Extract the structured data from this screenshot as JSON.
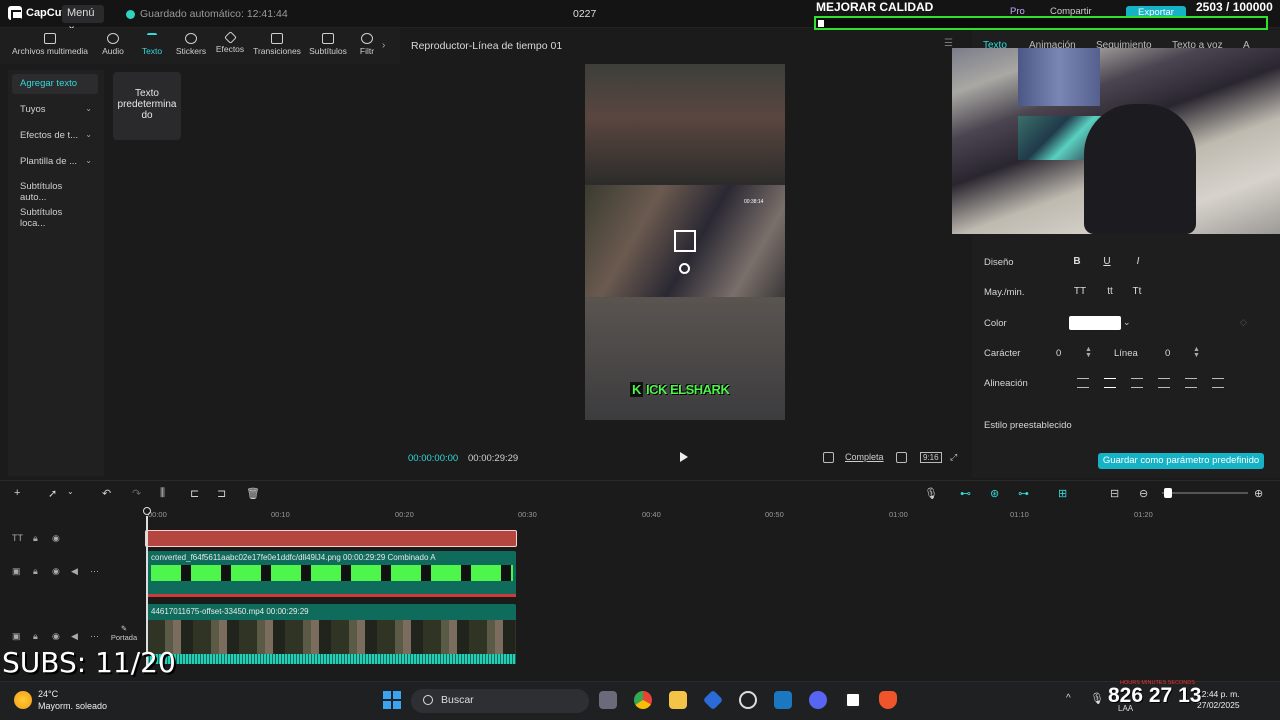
{
  "app": {
    "logo_text": "CapCut",
    "menu_label": "Menú",
    "autosave": "Guardado automático: 12:41:44",
    "project_name": "0227",
    "pro_label": "Pro",
    "share_label": "Compartir",
    "export_label": "Exportar"
  },
  "toolbar": {
    "items": [
      {
        "label": "Archivos multimedia",
        "icon": "media-icon"
      },
      {
        "label": "Audio",
        "icon": "audio-icon"
      },
      {
        "label": "Texto",
        "icon": "text-icon",
        "active": true
      },
      {
        "label": "Stickers",
        "icon": "sticker-icon"
      },
      {
        "label": "Efectos",
        "icon": "effects-icon"
      },
      {
        "label": "Transiciones",
        "icon": "transitions-icon"
      },
      {
        "label": "Subtítulos",
        "icon": "subtitles-icon"
      },
      {
        "label": "Filtr",
        "icon": "filters-icon"
      }
    ]
  },
  "left_panel": {
    "categories": [
      {
        "label": "Agregar texto",
        "active": true
      },
      {
        "label": "Tuyos",
        "dropdown": true
      },
      {
        "label": "Efectos de t...",
        "dropdown": true
      },
      {
        "label": "Plantilla de ...",
        "dropdown": true
      },
      {
        "label": "Subtítulos auto...",
        "dropdown": false
      },
      {
        "label": "Subtítulos loca...",
        "dropdown": false
      }
    ],
    "default_text_card": "Texto predetermina do"
  },
  "player": {
    "title": "Reproductor-Línea de tiempo 01",
    "video_timestamp": "00:38:14",
    "overlay_text": "KICK ELSHARK",
    "time_current": "00:00:00:00",
    "time_total": "00:00:29:29",
    "full_label": "Completa",
    "ratio_label": "9:16"
  },
  "inspector": {
    "tabs": [
      "Texto",
      "Animación",
      "Seguimiento",
      "Texto a voz",
      "A"
    ],
    "active_tab": "Texto",
    "labels": {
      "design": "Diseño",
      "case": "May./min.",
      "color": "Color",
      "character": "Carácter",
      "line": "Línea",
      "alignment": "Alineación",
      "preset_style": "Estilo preestablecido"
    },
    "design_buttons": [
      "B",
      "U",
      "I"
    ],
    "case_buttons": [
      "TT",
      "tt",
      "Tt"
    ],
    "color_value": "#ffffff",
    "character_value": "0",
    "line_value": "0",
    "save_preset": "Guardar como parámetro predefinido"
  },
  "stream_overlay": {
    "quality_label": "MEJORAR CALIDAD",
    "counter": "2503 / 100000",
    "quality_progress": 0.01,
    "subs_label": "SUBS: 11/20",
    "clock_labels": "HOURS   MINUTES   SECONDS",
    "clock": "826 27 13"
  },
  "timeline": {
    "ticks": [
      "00:00",
      "00:10",
      "00:20",
      "00:30",
      "00:40",
      "00:50",
      "01:00",
      "01:10",
      "01:20"
    ],
    "sticker_clip_label": "converted_f64f5611aabc02e17fe0e1ddfc/dll49lJ4.png   00:00:29:29   Combinado A",
    "video_clip_label": "44617011675-offset-33450.mp4   00:00:29:29",
    "cover_label": "Portada"
  },
  "taskbar": {
    "temperature": "24°C",
    "weather": "Mayorm. soleado",
    "search_placeholder": "Buscar",
    "tray_lang": "LAA",
    "tray_time": "12:44 p. m.",
    "tray_date": "27/02/2025"
  },
  "colors": {
    "accent": "#34d8d8",
    "export_button": "#16b3c7",
    "text_clip": "#b5453f",
    "clip_teal": "#0f6b5c",
    "quality_border": "#2fe02f",
    "overlay_green": "#4ef54a"
  }
}
